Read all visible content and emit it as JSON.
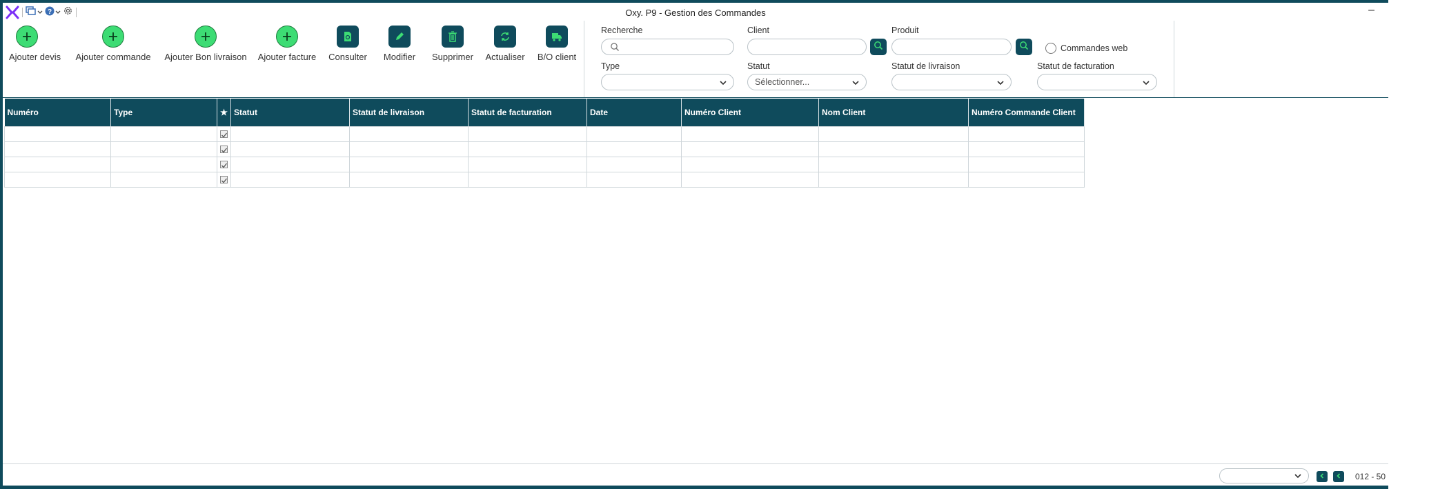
{
  "window": {
    "title": "Oxy. P9 - Gestion des Commandes",
    "minimize": "–"
  },
  "toolbar": {
    "buttons": [
      {
        "label": "Ajouter devis",
        "icon": "plus-icon"
      },
      {
        "label": "Ajouter commande",
        "icon": "plus-icon"
      },
      {
        "label": "Ajouter Bon livraison",
        "icon": "plus-icon"
      },
      {
        "label": "Ajouter facture",
        "icon": "plus-icon"
      },
      {
        "label": "Consulter",
        "icon": "document-icon"
      },
      {
        "label": "Modifier",
        "icon": "pencil-icon"
      },
      {
        "label": "Supprimer",
        "icon": "trash-icon"
      },
      {
        "label": "Actualiser",
        "icon": "refresh-icon"
      },
      {
        "label": "B/O client",
        "icon": "truck-icon"
      }
    ]
  },
  "filters": {
    "recherche": {
      "label": "Recherche",
      "value": ""
    },
    "client": {
      "label": "Client",
      "value": ""
    },
    "produit": {
      "label": "Produit",
      "value": ""
    },
    "commandes_web": {
      "label": "Commandes web",
      "checked": false
    },
    "type": {
      "label": "Type",
      "value": ""
    },
    "statut": {
      "label": "Statut",
      "value": "Sélectionner..."
    },
    "statut_livraison": {
      "label": "Statut de livraison",
      "value": ""
    },
    "statut_facturation": {
      "label": "Statut de facturation",
      "value": ""
    }
  },
  "table": {
    "columns": [
      "Numéro",
      "Type",
      "★",
      "Statut",
      "Statut de livraison",
      "Statut de facturation",
      "Date",
      "Numéro Client",
      "Nom Client",
      "Numéro Commande Client"
    ],
    "rows": [
      [
        "",
        "",
        "☑",
        "",
        "",
        "",
        "",
        "",
        "",
        ""
      ],
      [
        "",
        "",
        "☑",
        "",
        "",
        "",
        "",
        "",
        "",
        ""
      ],
      [
        "",
        "",
        "☑",
        "",
        "",
        "",
        "",
        "",
        "",
        ""
      ],
      [
        "",
        "",
        "☑",
        "",
        "",
        "",
        "",
        "",
        "",
        ""
      ]
    ]
  },
  "pager": {
    "select_value": "",
    "range_text": "012 - 50"
  },
  "colors": {
    "primary": "#0f4b5c",
    "add_green": "#3ddc74",
    "logo_purple": "#7b2ff7"
  }
}
